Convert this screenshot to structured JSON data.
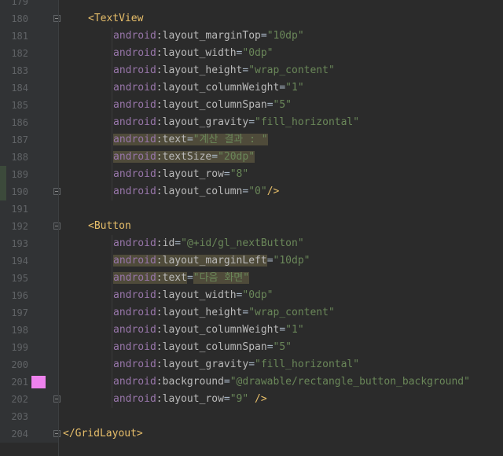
{
  "editor": {
    "colors": {
      "background": "#2b2b2b",
      "gutter": "#313335",
      "line_number": "#606366",
      "namespace": "#9876aa",
      "attribute": "#bababa",
      "string": "#6a8759",
      "tag": "#e8bf6a",
      "highlight": "#4f4b3a",
      "color_swatch": "#ee82ee",
      "change_marker": "#3c4a3b"
    },
    "lines": [
      {
        "num": "179",
        "indent": 0,
        "fold": false,
        "tokens": []
      },
      {
        "num": "180",
        "indent": 1,
        "fold": true,
        "tokens": [
          {
            "c": "tag",
            "t": "<TextView"
          }
        ]
      },
      {
        "num": "181",
        "indent": 2,
        "tokens": [
          {
            "c": "ns",
            "t": "android"
          },
          {
            "c": "attr",
            "t": ":layout_marginTop"
          },
          {
            "c": "plain",
            "t": "="
          },
          {
            "c": "str",
            "t": "\"10dp\""
          }
        ]
      },
      {
        "num": "182",
        "indent": 2,
        "tokens": [
          {
            "c": "ns",
            "t": "android"
          },
          {
            "c": "attr",
            "t": ":layout_width"
          },
          {
            "c": "plain",
            "t": "="
          },
          {
            "c": "str",
            "t": "\"0dp\""
          }
        ]
      },
      {
        "num": "183",
        "indent": 2,
        "tokens": [
          {
            "c": "ns",
            "t": "android"
          },
          {
            "c": "attr",
            "t": ":layout_height"
          },
          {
            "c": "plain",
            "t": "="
          },
          {
            "c": "str",
            "t": "\"wrap_content\""
          }
        ]
      },
      {
        "num": "184",
        "indent": 2,
        "tokens": [
          {
            "c": "ns",
            "t": "android"
          },
          {
            "c": "attr",
            "t": ":layout_columnWeight"
          },
          {
            "c": "plain",
            "t": "="
          },
          {
            "c": "str",
            "t": "\"1\""
          }
        ]
      },
      {
        "num": "185",
        "indent": 2,
        "tokens": [
          {
            "c": "ns",
            "t": "android"
          },
          {
            "c": "attr",
            "t": ":layout_columnSpan"
          },
          {
            "c": "plain",
            "t": "="
          },
          {
            "c": "str",
            "t": "\"5\""
          }
        ]
      },
      {
        "num": "186",
        "indent": 2,
        "tokens": [
          {
            "c": "ns",
            "t": "android"
          },
          {
            "c": "attr",
            "t": ":layout_gravity"
          },
          {
            "c": "plain",
            "t": "="
          },
          {
            "c": "str",
            "t": "\"fill_horizontal\""
          }
        ]
      },
      {
        "num": "187",
        "indent": 2,
        "highlight": true,
        "tokens": [
          {
            "c": "ns",
            "t": "android"
          },
          {
            "c": "attr",
            "t": ":text"
          },
          {
            "c": "plain",
            "t": "="
          },
          {
            "c": "str",
            "t": "\"계산 결과 : \""
          }
        ]
      },
      {
        "num": "188",
        "indent": 2,
        "highlight": true,
        "tokens": [
          {
            "c": "ns",
            "t": "android"
          },
          {
            "c": "attr",
            "t": ":textSize"
          },
          {
            "c": "plain",
            "t": "="
          },
          {
            "c": "str",
            "t": "\"20dp\""
          }
        ]
      },
      {
        "num": "189",
        "indent": 2,
        "changed": true,
        "tokens": [
          {
            "c": "ns",
            "t": "android"
          },
          {
            "c": "attr",
            "t": ":layout_row"
          },
          {
            "c": "plain",
            "t": "="
          },
          {
            "c": "str",
            "t": "\"8\""
          }
        ]
      },
      {
        "num": "190",
        "indent": 2,
        "fold": true,
        "changed": true,
        "tokens": [
          {
            "c": "ns",
            "t": "android"
          },
          {
            "c": "attr",
            "t": ":layout_column"
          },
          {
            "c": "plain",
            "t": "="
          },
          {
            "c": "str",
            "t": "\"0\""
          },
          {
            "c": "tag",
            "t": "/>"
          }
        ]
      },
      {
        "num": "191",
        "indent": 0,
        "tokens": []
      },
      {
        "num": "192",
        "indent": 1,
        "fold": true,
        "tokens": [
          {
            "c": "tag",
            "t": "<Button"
          }
        ]
      },
      {
        "num": "193",
        "indent": 2,
        "tokens": [
          {
            "c": "ns",
            "t": "android"
          },
          {
            "c": "attr",
            "t": ":id"
          },
          {
            "c": "plain",
            "t": "="
          },
          {
            "c": "str",
            "t": "\"@+id/gl_nextButton\""
          }
        ]
      },
      {
        "num": "194",
        "indent": 2,
        "partial": true,
        "tokens": [
          {
            "c": "ns hl",
            "t": "android"
          },
          {
            "c": "attr hl",
            "t": ":layout_marginLeft"
          },
          {
            "c": "plain",
            "t": "="
          },
          {
            "c": "str",
            "t": "\"10dp\""
          }
        ]
      },
      {
        "num": "195",
        "indent": 2,
        "partial": true,
        "tokens": [
          {
            "c": "ns hl",
            "t": "android"
          },
          {
            "c": "attr hl",
            "t": ":text"
          },
          {
            "c": "plain",
            "t": "="
          },
          {
            "c": "str hl",
            "t": "\"다음 화면\""
          }
        ]
      },
      {
        "num": "196",
        "indent": 2,
        "tokens": [
          {
            "c": "ns",
            "t": "android"
          },
          {
            "c": "attr",
            "t": ":layout_width"
          },
          {
            "c": "plain",
            "t": "="
          },
          {
            "c": "str",
            "t": "\"0dp\""
          }
        ]
      },
      {
        "num": "197",
        "indent": 2,
        "tokens": [
          {
            "c": "ns",
            "t": "android"
          },
          {
            "c": "attr",
            "t": ":layout_height"
          },
          {
            "c": "plain",
            "t": "="
          },
          {
            "c": "str",
            "t": "\"wrap_content\""
          }
        ]
      },
      {
        "num": "198",
        "indent": 2,
        "tokens": [
          {
            "c": "ns",
            "t": "android"
          },
          {
            "c": "attr",
            "t": ":layout_columnWeight"
          },
          {
            "c": "plain",
            "t": "="
          },
          {
            "c": "str",
            "t": "\"1\""
          }
        ]
      },
      {
        "num": "199",
        "indent": 2,
        "tokens": [
          {
            "c": "ns",
            "t": "android"
          },
          {
            "c": "attr",
            "t": ":layout_columnSpan"
          },
          {
            "c": "plain",
            "t": "="
          },
          {
            "c": "str",
            "t": "\"5\""
          }
        ]
      },
      {
        "num": "200",
        "indent": 2,
        "tokens": [
          {
            "c": "ns",
            "t": "android"
          },
          {
            "c": "attr",
            "t": ":layout_gravity"
          },
          {
            "c": "plain",
            "t": "="
          },
          {
            "c": "str",
            "t": "\"fill_horizontal\""
          }
        ]
      },
      {
        "num": "201",
        "indent": 2,
        "swatch": true,
        "tokens": [
          {
            "c": "ns",
            "t": "android"
          },
          {
            "c": "attr",
            "t": ":background"
          },
          {
            "c": "plain",
            "t": "="
          },
          {
            "c": "str",
            "t": "\"@drawable/rectangle_button_background\""
          }
        ]
      },
      {
        "num": "202",
        "indent": 2,
        "fold": true,
        "tokens": [
          {
            "c": "ns",
            "t": "android"
          },
          {
            "c": "attr",
            "t": ":layout_row"
          },
          {
            "c": "plain",
            "t": "="
          },
          {
            "c": "str",
            "t": "\"9\""
          },
          {
            "c": "plain",
            "t": " "
          },
          {
            "c": "tag",
            "t": "/>"
          }
        ]
      },
      {
        "num": "203",
        "indent": 0,
        "tokens": []
      },
      {
        "num": "204",
        "indent": 0,
        "fold": true,
        "tokens": [
          {
            "c": "tag",
            "t": "</GridLayout>"
          }
        ]
      }
    ]
  }
}
